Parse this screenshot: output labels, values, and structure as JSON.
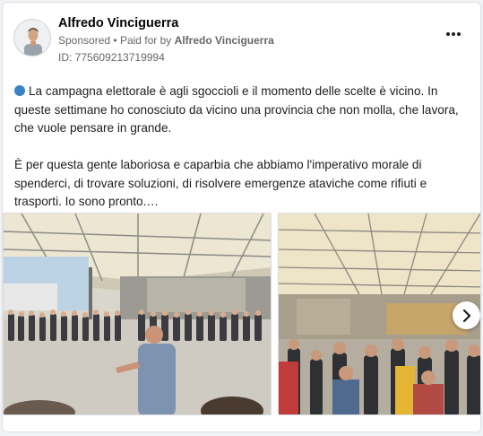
{
  "post": {
    "author": "Alfredo Vinciguerra",
    "sponsored_label": "Sponsored",
    "paid_by_prefix": "Paid for by",
    "paid_by": "Alfredo Vinciguerra",
    "separator": "•",
    "ad_id": "ID: 775609213719994",
    "paragraph1": "La campagna elettorale è agli sgoccioli e il momento delle scelte è vicino. In queste settimane ho conosciuto da vicino una provincia che non molla, che lavora, che vuole pensare in grande.",
    "paragraph2": "È per questa gente laboriosa e caparbia che abbiamo l'imperativo morale di spenderci, di trovare soluzioni, di risolvere emergenze ataviche come rifiuti e trasporti. Io sono pronto.…"
  },
  "icons": {
    "bullet": "blue-circle-icon",
    "more": "more-horizontal-icon",
    "next": "chevron-right-icon"
  },
  "colors": {
    "bullet": "#3b82c4",
    "secondary_text": "#65676b",
    "primary_text": "#1c1e21"
  }
}
